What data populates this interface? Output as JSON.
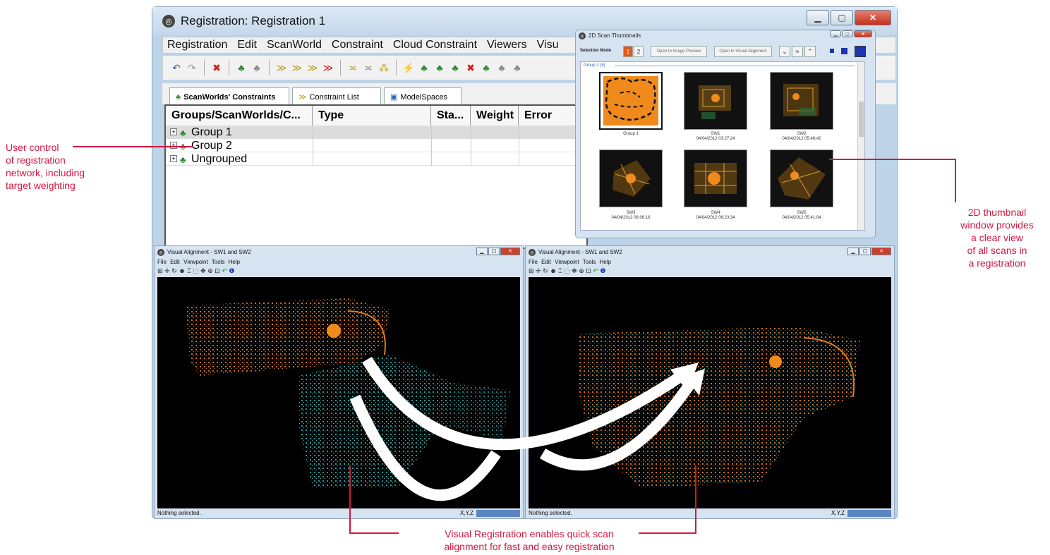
{
  "annotations": {
    "left": [
      "User control",
      "of registration",
      "network, including",
      "target weighting"
    ],
    "right": [
      "2D thumbnail",
      "window provides",
      "a clear view",
      "of all scans in",
      "a registration"
    ],
    "bottom": [
      "Visual Registration enables quick scan",
      "alignment for fast and easy registration"
    ]
  },
  "main_window": {
    "title": "Registration: Registration 1",
    "menu": [
      "Registration",
      "Edit",
      "ScanWorld",
      "Constraint",
      "Cloud Constraint",
      "Viewers",
      "Visu"
    ],
    "tabs": [
      "ScanWorlds' Constraints",
      "Constraint List",
      "ModelSpaces"
    ],
    "columns": [
      "Groups/ScanWorlds/C...",
      "Type",
      "Sta...",
      "Weight",
      "Error"
    ],
    "rows": [
      "Group 1",
      "Group 2",
      "Ungrouped"
    ]
  },
  "thumbnails_window": {
    "title": "2D Scan Thumbnails",
    "selection_mode_label": "Selection Mode",
    "mode_1": "1",
    "mode_2": "2",
    "open_image_preview": "Open In Image Preview",
    "open_visual_alignment": "Open In Visual Alignment",
    "group_header": "Group 1 (5)",
    "items": [
      {
        "name": "Group 1",
        "date": ""
      },
      {
        "name": "SW1",
        "date": "04/04/2012 03:27:24"
      },
      {
        "name": "SW2",
        "date": "04/04/2012 05:48:42"
      },
      {
        "name": "SW3",
        "date": "04/04/2012 06:06:16"
      },
      {
        "name": "SW4",
        "date": "04/04/2012 06:23:34"
      },
      {
        "name": "SW5",
        "date": "04/04/2012 05:41:04"
      }
    ]
  },
  "visual_alignment": {
    "title": "Visual Alignment - SW1 and SW2",
    "menu": "File  Edit  Viewpoint  Tools  Help",
    "status": "Nothing selected.",
    "coords": "X,Y,Z"
  },
  "colors": {
    "accent": "#d7163f",
    "scan_orange": "#e07a1c",
    "scan_cyan": "#2fb3b0"
  }
}
